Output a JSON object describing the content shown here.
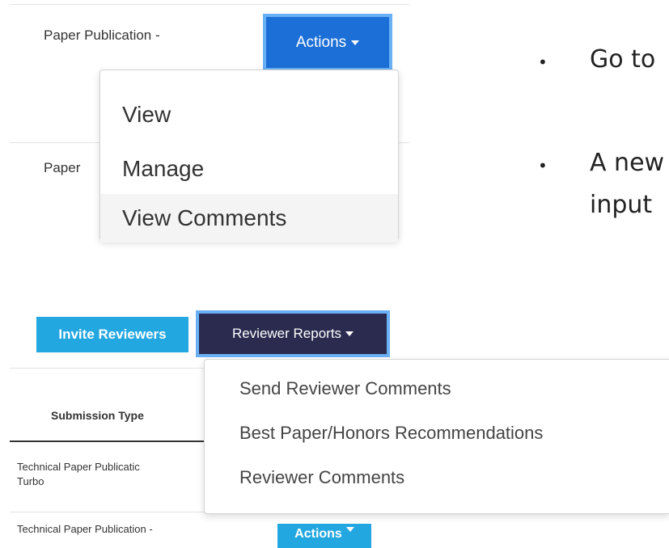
{
  "top_table": {
    "row1_text": "Paper Publication -",
    "row2_text": "Paper",
    "actions_label": "Actions"
  },
  "actions_menu": {
    "items": [
      {
        "label": "View"
      },
      {
        "label": "Manage"
      },
      {
        "label": "View Comments",
        "highlighted": true
      }
    ]
  },
  "bullets": [
    {
      "text": "Go to"
    },
    {
      "text": "A new"
    },
    {
      "text": "input"
    }
  ],
  "toolbar": {
    "invite_label": "Invite Reviewers",
    "reports_label": "Reviewer Reports"
  },
  "submissions_table": {
    "header": "Submission Type",
    "rows": [
      {
        "line1": "Technical Paper Publicatic",
        "line2": "Turbo"
      },
      {
        "line1": "Technical Paper Publication -"
      }
    ],
    "actions_label": "Actions"
  },
  "reports_menu": {
    "items": [
      {
        "label": "Send Reviewer Comments"
      },
      {
        "label": "Best Paper/Honors Recommendations"
      },
      {
        "label": "Reviewer Comments"
      }
    ]
  },
  "colors": {
    "actions_primary": "#1c6fd6",
    "focus_ring": "#6ab0f5",
    "invite_button": "#23a7e0",
    "reports_button": "#2a2b4e",
    "menu_highlight": "#f4f4f4"
  }
}
